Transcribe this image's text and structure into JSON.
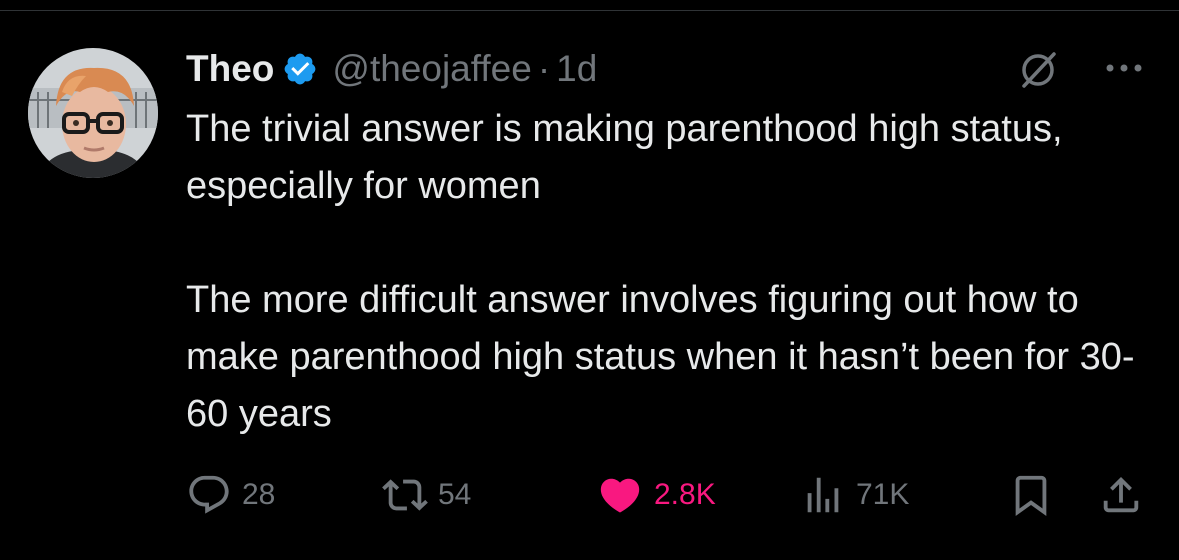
{
  "tweet": {
    "author": {
      "display_name": "Theo",
      "handle": "@theojaffee",
      "verified": true
    },
    "separator": "·",
    "time": "1d",
    "text_paragraphs": [
      "The trivial answer is making parenthood high status, especially for women",
      "The more difficult answer involves figuring out how to make parenthood high status when it hasn’t been for 30-60 years"
    ]
  },
  "actions": {
    "replies": "28",
    "reposts": "54",
    "likes": "2.8K",
    "views": "71K"
  },
  "colors": {
    "background": "#000000",
    "text_primary": "#e7e9ea",
    "text_secondary": "#71767b",
    "verified": "#1d9bf0",
    "like": "#f91880",
    "divider": "#2f3336"
  },
  "icons": {
    "verified": "verified-badge-icon",
    "grok": "grok-icon",
    "more": "more-icon",
    "reply": "reply-icon",
    "repost": "repost-icon",
    "like": "heart-icon",
    "views": "views-icon",
    "bookmark": "bookmark-icon",
    "share": "share-icon"
  }
}
